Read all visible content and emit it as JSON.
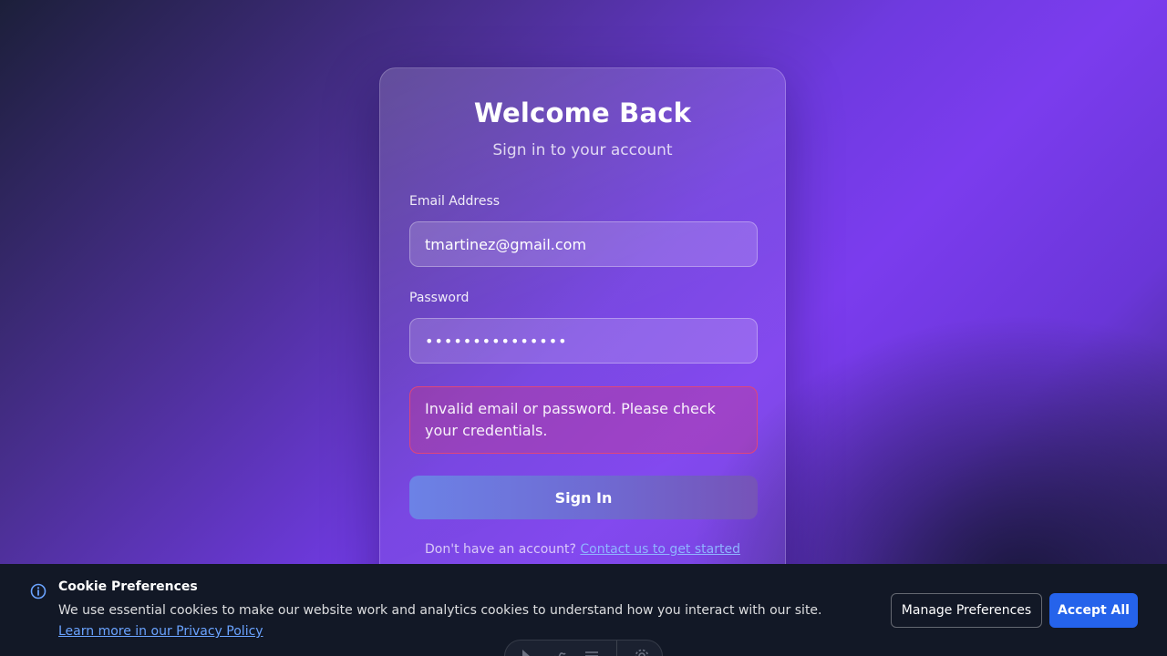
{
  "login": {
    "title": "Welcome Back",
    "subtitle": "Sign in to your account",
    "email_label": "Email Address",
    "email_value": "tmartinez@gmail.com",
    "password_label": "Password",
    "password_value": "•••••••••••••••",
    "error_message": "Invalid email or password. Please check your credentials.",
    "signin_label": "Sign In",
    "signup_prompt": "Don't have an account?",
    "signup_link": "Contact us to get started"
  },
  "cookie_banner": {
    "title": "Cookie Preferences",
    "text": "We use essential cookies to make our website work and analytics cookies to understand how you interact with our site.",
    "link": "Learn more in our Privacy Policy",
    "manage_label": "Manage Preferences",
    "accept_label": "Accept All",
    "icon": "info-icon"
  },
  "toolbar": {
    "icons": [
      "pointer-icon",
      "gesture-icon",
      "menu-icon",
      "settings-icon"
    ]
  },
  "colors": {
    "accent": "#2563eb",
    "error_border": "#e0457a",
    "link": "#6aa3ff",
    "banner_bg": "#121826"
  }
}
